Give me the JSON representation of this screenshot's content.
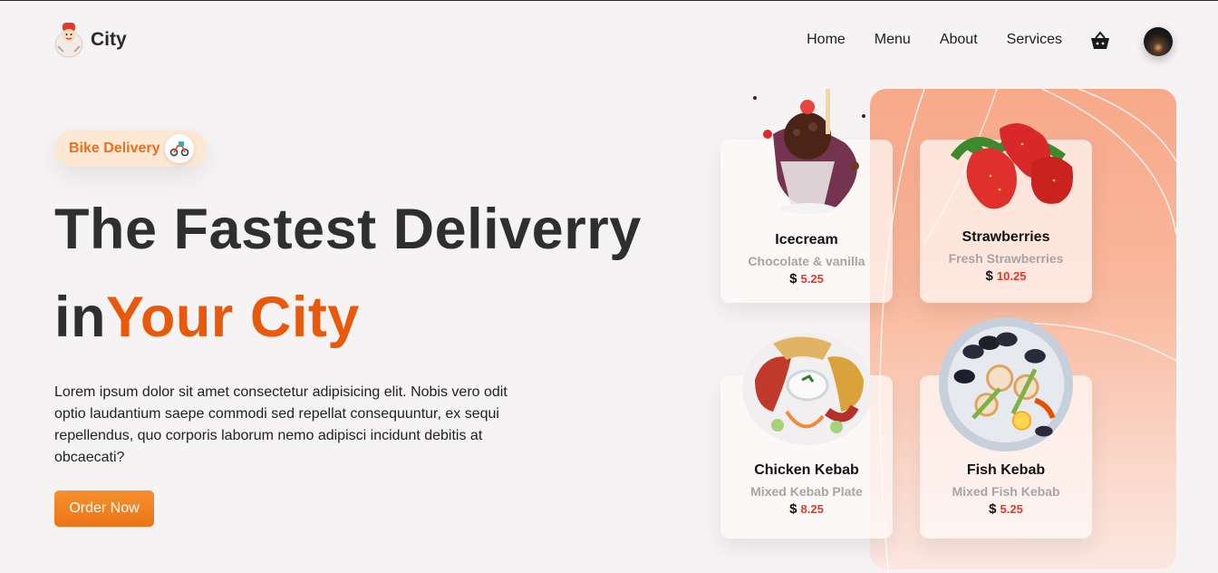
{
  "header": {
    "brand": "City",
    "nav": [
      "Home",
      "Menu",
      "About",
      "Services"
    ],
    "icons": {
      "cart": "basket-icon",
      "avatar": "user-avatar"
    }
  },
  "hero": {
    "badge": "Bike Delivery",
    "title_line1": "The Fastest Deliverry",
    "title_line2_prefix": "in",
    "title_line2_accent": "Your City",
    "description": "Lorem ipsum dolor sit amet consectetur adipisicing elit. Nobis vero odit optio laudantium saepe commodi sed repellat consequuntur, ex sequi repellendus, quo corporis laborum nemo adipisci incidunt debitis at obcaecati?",
    "cta": "Order Now"
  },
  "colors": {
    "accent": "#e8590c",
    "button": "#f08322",
    "badge_bg": "#fde8d4",
    "price": "#e23a2a"
  },
  "cards": [
    {
      "name": "Icecream",
      "desc": "Chocolate & vanilla",
      "currency": "$",
      "price": "5.25"
    },
    {
      "name": "Strawberries",
      "desc": "Fresh Strawberries",
      "currency": "$",
      "price": "10.25"
    },
    {
      "name": "Chicken Kebab",
      "desc": "Mixed Kebab Plate",
      "currency": "$",
      "price": "8.25"
    },
    {
      "name": "Fish Kebab",
      "desc": "Mixed Fish Kebab",
      "currency": "$",
      "price": "5.25"
    }
  ]
}
